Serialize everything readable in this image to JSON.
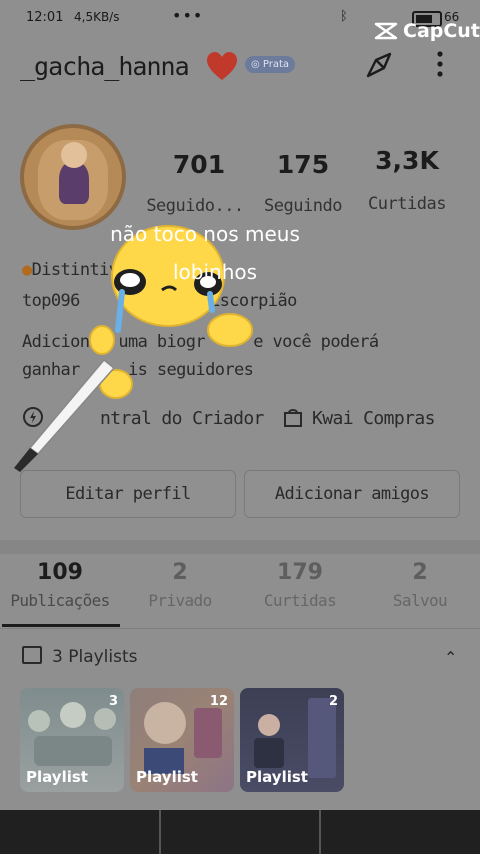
{
  "status_bar": {
    "time": "12:01",
    "network": "4,5KB/s",
    "battery": "66"
  },
  "watermark": "CapCut",
  "profile": {
    "username": "_gacha_hanna",
    "badge": "Prata",
    "stats": [
      {
        "value": "701",
        "label": "Seguido..."
      },
      {
        "value": "175",
        "label": "Seguindo"
      },
      {
        "value": "3,3K",
        "label": "Curtidas"
      }
    ],
    "distinctive": "Distintiv",
    "tags_left": "top096",
    "tags_right": "Escorpião",
    "bio_line1": "Adicion   uma biogr     e você poderá",
    "bio_line2": "ganhar     is seguidores",
    "creator_center": "ntral do Criador",
    "kwai_shop": "Kwai Compras",
    "edit_profile": "Editar perfil",
    "add_friends": "Adicionar amigos"
  },
  "overlay": {
    "line1": "não toco nos meus",
    "line2": "lobinhos"
  },
  "tabs": [
    {
      "count": "109",
      "label": "Publicações"
    },
    {
      "count": "2",
      "label": "Privado"
    },
    {
      "count": "179",
      "label": "Curtidas"
    },
    {
      "count": "2",
      "label": "Salvou"
    }
  ],
  "playlists": {
    "header": "3 Playlists",
    "items": [
      {
        "label": "Playlist",
        "count": "3"
      },
      {
        "label": "Playlist",
        "count": "12"
      },
      {
        "label": "Playlist",
        "count": "2"
      }
    ]
  },
  "colors": {
    "heart": "#c0392b",
    "badge_bg": "#6c7a9c",
    "emoji_yellow": "#ffd84a"
  }
}
